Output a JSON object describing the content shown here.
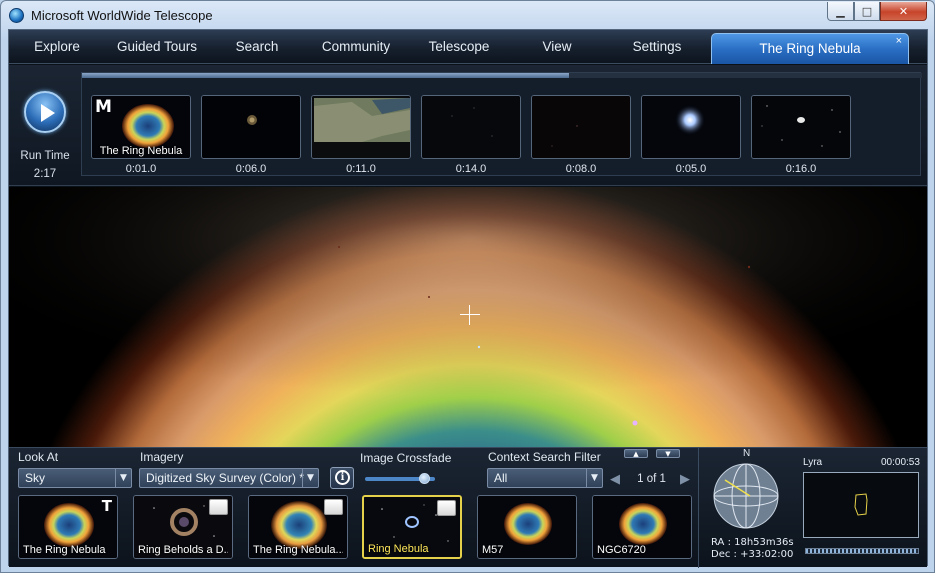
{
  "window": {
    "title": "Microsoft WorldWide Telescope",
    "minimize_glyph": "▁",
    "maximize_glyph": "□",
    "close_glyph": "✕"
  },
  "nav": {
    "items": [
      "Explore",
      "Guided Tours",
      "Search",
      "Community",
      "Telescope",
      "View",
      "Settings"
    ],
    "active_tab": "The Ring Nebula",
    "active_tab_close": "×"
  },
  "tour": {
    "play_icon": "play-icon",
    "run_time_label": "Run Time",
    "run_time_value": "2:17",
    "progress": 0.58,
    "slides": [
      {
        "time": "0:01.0",
        "caption": "The Ring Nebula",
        "badge": "M"
      },
      {
        "time": "0:06.0",
        "caption": "",
        "badge": ""
      },
      {
        "time": "0:11.0",
        "caption": "",
        "badge": ""
      },
      {
        "time": "0:14.0",
        "caption": "",
        "badge": ""
      },
      {
        "time": "0:08.0",
        "caption": "",
        "badge": ""
      },
      {
        "time": "0:05.0",
        "caption": "",
        "badge": ""
      },
      {
        "time": "0:16.0",
        "caption": "",
        "badge": ""
      }
    ]
  },
  "explore": {
    "look_at_label": "Look At",
    "look_at_value": "Sky",
    "imagery_label": "Imagery",
    "imagery_value": "Digitized Sky Survey (Color) *",
    "crossfade_label": "Image Crossfade",
    "crossfade_value": 0.85,
    "context_filter_label": "Context Search Filter",
    "context_filter_value": "All",
    "page_indicator": "1 of 1",
    "info_glyph": "i",
    "results": [
      {
        "caption": "The Ring Nebula",
        "tag": "T",
        "selected": false
      },
      {
        "caption": "Ring Beholds a D...",
        "tag": "image",
        "selected": false
      },
      {
        "caption": "The Ring Nebula...",
        "tag": "image",
        "selected": false
      },
      {
        "caption": "Ring Nebula",
        "tag": "image",
        "selected": true
      },
      {
        "caption": "M57",
        "tag": "",
        "selected": false
      },
      {
        "caption": "NGC6720",
        "tag": "",
        "selected": false
      }
    ]
  },
  "navigator": {
    "compass_north": "N",
    "ra": "RA :   18h53m36s",
    "dec": "Dec :  +33:02:00",
    "constellation": "Lyra",
    "timer": "00:00:53"
  },
  "colors": {
    "accent": "#2a6fc4",
    "selected_border": "#e6d24a",
    "panel_bg": "#1b2533"
  }
}
